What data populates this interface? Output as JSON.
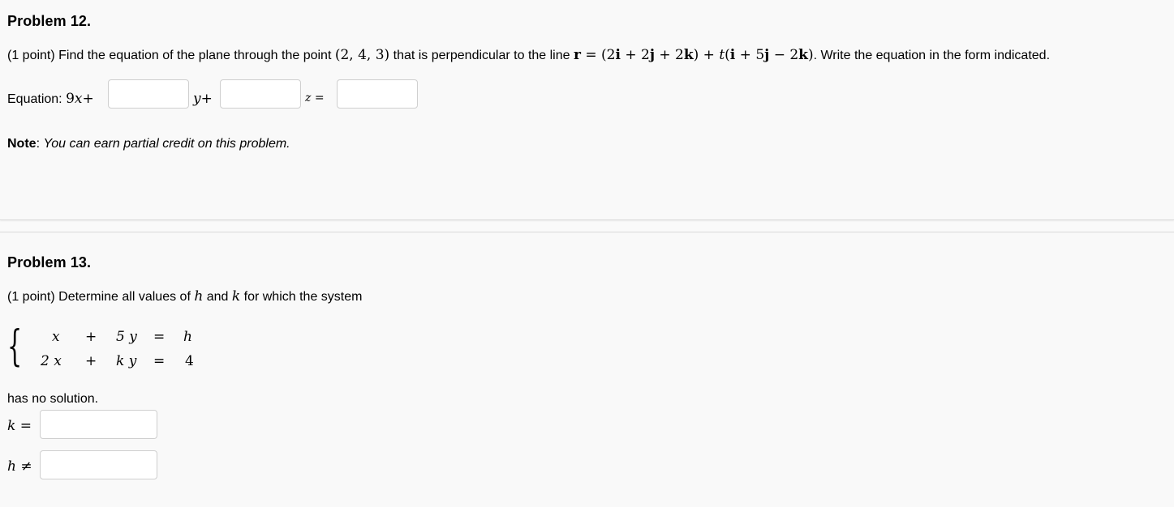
{
  "problem12": {
    "title": "Problem 12.",
    "text_pre": "(1 point) Find the equation of the plane through the point ",
    "point": "(2, 4, 3)",
    "text_mid": " that is perpendicular to the line ",
    "line_r": "r",
    "line_eq": " = ",
    "line_expr_1": "(2",
    "i": "i",
    "plus_2": " + 2",
    "j": "j",
    "k": "k",
    "close_plus_t": ") + ",
    "t": "t",
    "open_i": "(",
    "plus_5": " + 5",
    "minus_2": " − 2",
    "close": ")",
    "text_post": ". Write the equation in the form indicated.",
    "equation_label": "Equation: ",
    "eq_9": "9",
    "eq_x": "x",
    "eq_plus": "+",
    "eq_y": "y",
    "eq_z": "z",
    "eq_equals": " =",
    "answer_1_value": "",
    "answer_2_value": "",
    "answer_3_value": "",
    "note_label": "Note",
    "note_colon": ": ",
    "note_text": "You can earn partial credit on this problem."
  },
  "problem13": {
    "title": "Problem 13.",
    "text_pre": "(1 point) Determine all values of ",
    "h": "h",
    "and": " and ",
    "k": "k",
    "text_post": " for which the system",
    "system": {
      "row1": [
        "x",
        "+",
        "5 y",
        "=",
        "h"
      ],
      "row2": [
        "2 x",
        "+",
        "k y",
        "=",
        "4"
      ]
    },
    "no_solution": "has no solution.",
    "k_label": "k",
    "equals": " =",
    "h_label": "h",
    "neq": " ≠",
    "answer_k_value": "",
    "answer_h_value": ""
  }
}
